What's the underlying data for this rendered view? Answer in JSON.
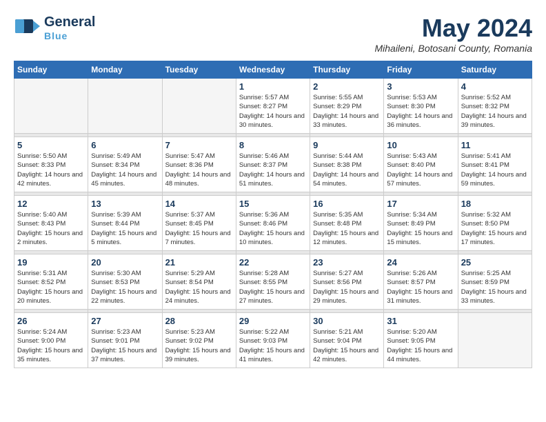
{
  "logo": {
    "line1a": "General",
    "line1b": "Blue",
    "line2": "Blue"
  },
  "title": {
    "month_year": "May 2024",
    "location": "Mihaileni, Botosani County, Romania"
  },
  "weekdays": [
    "Sunday",
    "Monday",
    "Tuesday",
    "Wednesday",
    "Thursday",
    "Friday",
    "Saturday"
  ],
  "weeks": [
    [
      {
        "day": "",
        "info": ""
      },
      {
        "day": "",
        "info": ""
      },
      {
        "day": "",
        "info": ""
      },
      {
        "day": "1",
        "info": "Sunrise: 5:57 AM\nSunset: 8:27 PM\nDaylight: 14 hours\nand 30 minutes."
      },
      {
        "day": "2",
        "info": "Sunrise: 5:55 AM\nSunset: 8:29 PM\nDaylight: 14 hours\nand 33 minutes."
      },
      {
        "day": "3",
        "info": "Sunrise: 5:53 AM\nSunset: 8:30 PM\nDaylight: 14 hours\nand 36 minutes."
      },
      {
        "day": "4",
        "info": "Sunrise: 5:52 AM\nSunset: 8:32 PM\nDaylight: 14 hours\nand 39 minutes."
      }
    ],
    [
      {
        "day": "5",
        "info": "Sunrise: 5:50 AM\nSunset: 8:33 PM\nDaylight: 14 hours\nand 42 minutes."
      },
      {
        "day": "6",
        "info": "Sunrise: 5:49 AM\nSunset: 8:34 PM\nDaylight: 14 hours\nand 45 minutes."
      },
      {
        "day": "7",
        "info": "Sunrise: 5:47 AM\nSunset: 8:36 PM\nDaylight: 14 hours\nand 48 minutes."
      },
      {
        "day": "8",
        "info": "Sunrise: 5:46 AM\nSunset: 8:37 PM\nDaylight: 14 hours\nand 51 minutes."
      },
      {
        "day": "9",
        "info": "Sunrise: 5:44 AM\nSunset: 8:38 PM\nDaylight: 14 hours\nand 54 minutes."
      },
      {
        "day": "10",
        "info": "Sunrise: 5:43 AM\nSunset: 8:40 PM\nDaylight: 14 hours\nand 57 minutes."
      },
      {
        "day": "11",
        "info": "Sunrise: 5:41 AM\nSunset: 8:41 PM\nDaylight: 14 hours\nand 59 minutes."
      }
    ],
    [
      {
        "day": "12",
        "info": "Sunrise: 5:40 AM\nSunset: 8:43 PM\nDaylight: 15 hours\nand 2 minutes."
      },
      {
        "day": "13",
        "info": "Sunrise: 5:39 AM\nSunset: 8:44 PM\nDaylight: 15 hours\nand 5 minutes."
      },
      {
        "day": "14",
        "info": "Sunrise: 5:37 AM\nSunset: 8:45 PM\nDaylight: 15 hours\nand 7 minutes."
      },
      {
        "day": "15",
        "info": "Sunrise: 5:36 AM\nSunset: 8:46 PM\nDaylight: 15 hours\nand 10 minutes."
      },
      {
        "day": "16",
        "info": "Sunrise: 5:35 AM\nSunset: 8:48 PM\nDaylight: 15 hours\nand 12 minutes."
      },
      {
        "day": "17",
        "info": "Sunrise: 5:34 AM\nSunset: 8:49 PM\nDaylight: 15 hours\nand 15 minutes."
      },
      {
        "day": "18",
        "info": "Sunrise: 5:32 AM\nSunset: 8:50 PM\nDaylight: 15 hours\nand 17 minutes."
      }
    ],
    [
      {
        "day": "19",
        "info": "Sunrise: 5:31 AM\nSunset: 8:52 PM\nDaylight: 15 hours\nand 20 minutes."
      },
      {
        "day": "20",
        "info": "Sunrise: 5:30 AM\nSunset: 8:53 PM\nDaylight: 15 hours\nand 22 minutes."
      },
      {
        "day": "21",
        "info": "Sunrise: 5:29 AM\nSunset: 8:54 PM\nDaylight: 15 hours\nand 24 minutes."
      },
      {
        "day": "22",
        "info": "Sunrise: 5:28 AM\nSunset: 8:55 PM\nDaylight: 15 hours\nand 27 minutes."
      },
      {
        "day": "23",
        "info": "Sunrise: 5:27 AM\nSunset: 8:56 PM\nDaylight: 15 hours\nand 29 minutes."
      },
      {
        "day": "24",
        "info": "Sunrise: 5:26 AM\nSunset: 8:57 PM\nDaylight: 15 hours\nand 31 minutes."
      },
      {
        "day": "25",
        "info": "Sunrise: 5:25 AM\nSunset: 8:59 PM\nDaylight: 15 hours\nand 33 minutes."
      }
    ],
    [
      {
        "day": "26",
        "info": "Sunrise: 5:24 AM\nSunset: 9:00 PM\nDaylight: 15 hours\nand 35 minutes."
      },
      {
        "day": "27",
        "info": "Sunrise: 5:23 AM\nSunset: 9:01 PM\nDaylight: 15 hours\nand 37 minutes."
      },
      {
        "day": "28",
        "info": "Sunrise: 5:23 AM\nSunset: 9:02 PM\nDaylight: 15 hours\nand 39 minutes."
      },
      {
        "day": "29",
        "info": "Sunrise: 5:22 AM\nSunset: 9:03 PM\nDaylight: 15 hours\nand 41 minutes."
      },
      {
        "day": "30",
        "info": "Sunrise: 5:21 AM\nSunset: 9:04 PM\nDaylight: 15 hours\nand 42 minutes."
      },
      {
        "day": "31",
        "info": "Sunrise: 5:20 AM\nSunset: 9:05 PM\nDaylight: 15 hours\nand 44 minutes."
      },
      {
        "day": "",
        "info": ""
      }
    ]
  ]
}
